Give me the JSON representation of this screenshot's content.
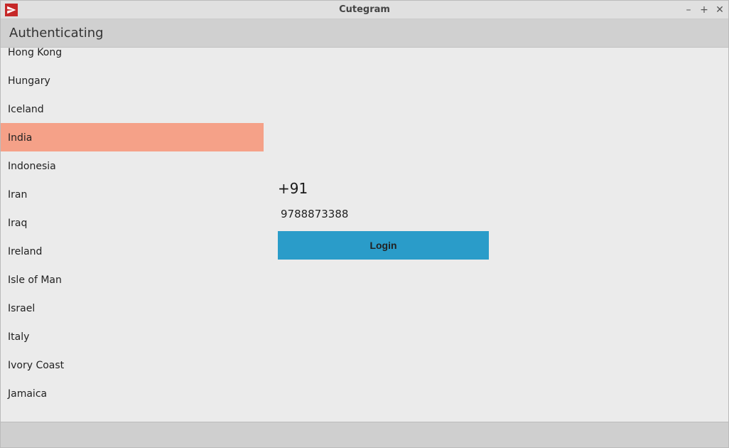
{
  "window": {
    "title": "Cutegram"
  },
  "header": {
    "title": "Authenticating"
  },
  "countries": {
    "items": [
      "Hong Kong",
      "Hungary",
      "Iceland",
      "India",
      "Indonesia",
      "Iran",
      "Iraq",
      "Ireland",
      "Isle of Man",
      "Israel",
      "Italy",
      "Ivory Coast",
      "Jamaica"
    ],
    "selected_index": 3
  },
  "form": {
    "country_code": "+91",
    "phone_value": "9788873388",
    "login_label": "Login"
  },
  "icons": {
    "app": "paper-plane-icon",
    "minimize": "minimize-icon",
    "maximize": "maximize-icon",
    "close": "close-icon"
  },
  "colors": {
    "selected_bg": "#f5a188",
    "button_bg": "#2a9cc9",
    "client_bg": "#ebebeb",
    "chrome_bg": "#cfcfcf"
  }
}
